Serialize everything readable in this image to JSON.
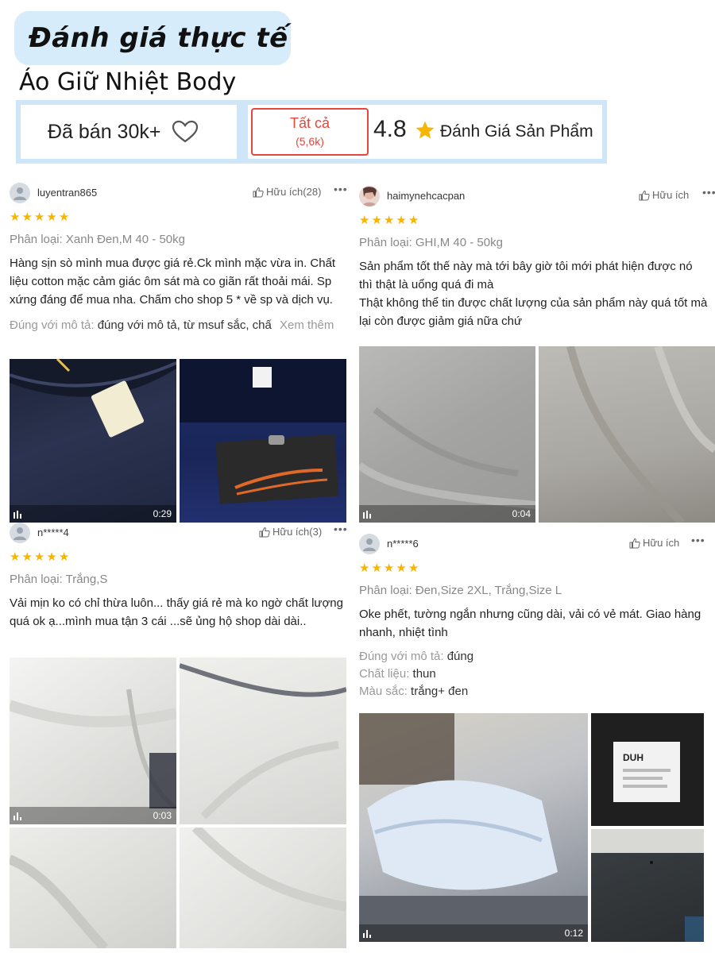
{
  "header": {
    "hero_title": "Đánh giá thực tế",
    "product_title": "Áo Giữ Nhiệt Body"
  },
  "stats": {
    "sold_label": "Đã bán 30k+",
    "filter_label": "Tất cả",
    "filter_count": "(5,6k)",
    "score": "4.8",
    "rating_label": "Đánh Giá Sản Phẩm"
  },
  "colors": {
    "accent_red": "#e8463b",
    "star_yellow": "#f7b500",
    "header_blue": "#d6ecfa",
    "bar_blue": "#cfe5f8"
  },
  "reviews": [
    {
      "username": "luyentran865",
      "helpful": "Hữu ích(28)",
      "more": "•••",
      "stars": 5,
      "variant": "Phân loại: Xanh Đen,M 40 - 50kg",
      "text": "Hàng sịn sò mình mua được giá rẻ.Ck mình mặc vừa in. Chất liệu cotton mặc cảm giác  ôm sát mà co giãn rất thoải mái. Sp xứng đáng để mua nha. Chấm cho shop 5 * về sp và dịch vụ.",
      "detail_key": "Đúng với mô tả:",
      "detail_val": "đúng với mô tả, từ msuf sắc, chấ",
      "see_more": "Xem thêm",
      "video_time": "0:29"
    },
    {
      "username": "haimynehcacpan",
      "helpful": "Hữu ích",
      "more": "•••",
      "stars": 5,
      "variant": "Phân loại: GHI,M 40 - 50kg",
      "text": "Sản phẩm tốt thế này mà tới bây giờ tôi mới phát hiện được nó thì thật là uổng quá đi mà\nThật không thể tin được chất lượng của sản phẩm này quá tốt mà lại còn được giảm giá nữa chứ",
      "video_time": "0:04"
    },
    {
      "username": "n*****4",
      "helpful": "Hữu ích(3)",
      "more": "•••",
      "stars": 5,
      "variant": "Phân loại: Trắng,S",
      "text": "Vải mịn ko có chỉ thừa luôn... thấy giá rẻ mà ko ngờ chất lượng quá ok ạ...mình mua tận 3 cái ...sẽ ủng hộ shop dài dài..",
      "video_time": "0:03"
    },
    {
      "username": "n*****6",
      "helpful": "Hữu ích",
      "more": "•••",
      "stars": 5,
      "variant": "Phân loại: Đen,Size 2XL, Trắng,Size L",
      "text": "Oke phết, tường ngắn nhưng cũng dài, vải có vẻ mát. Giao hàng nhanh, nhiệt tình",
      "details": [
        {
          "k": "Đúng với mô tả:",
          "v": "đúng"
        },
        {
          "k": "Chất liệu:",
          "v": "thun"
        },
        {
          "k": "Màu sắc:",
          "v": "trắng+ đen"
        }
      ],
      "video_time": "0:12",
      "label_code": "DUH"
    }
  ],
  "icons": {
    "heart": "heart-icon",
    "star": "star-icon",
    "thumb": "thumbs-up-icon",
    "avatar": "user-avatar-icon",
    "video": "video-play-icon"
  }
}
